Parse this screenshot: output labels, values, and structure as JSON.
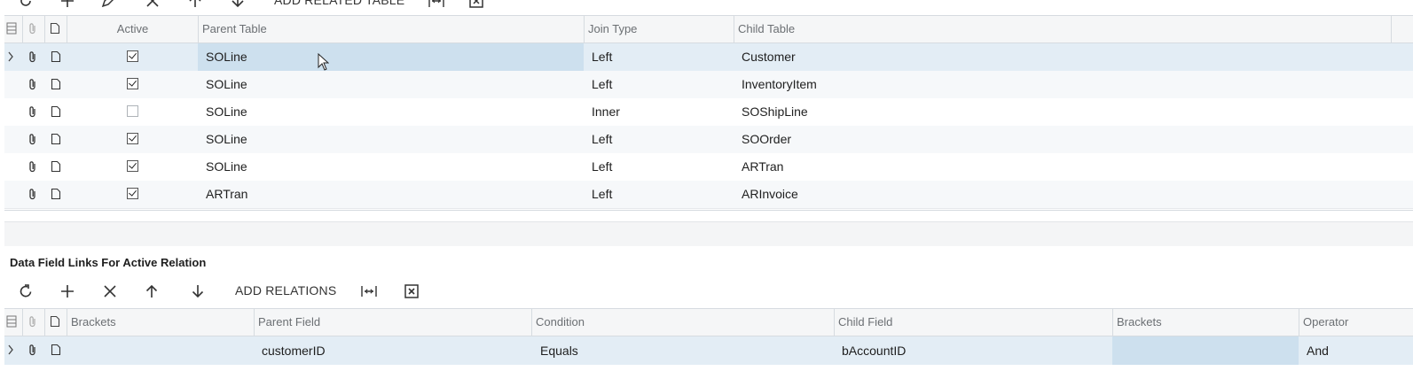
{
  "top_toolbar": {
    "add_related_table_label": "ADD RELATED TABLE"
  },
  "relations_grid": {
    "columns": {
      "active": "Active",
      "parent_table": "Parent Table",
      "join_type": "Join Type",
      "child_table": "Child Table"
    },
    "rows": [
      {
        "active": true,
        "parent_table": "SOLine",
        "join_type": "Left",
        "child_table": "Customer"
      },
      {
        "active": true,
        "parent_table": "SOLine",
        "join_type": "Left",
        "child_table": "InventoryItem"
      },
      {
        "active": false,
        "parent_table": "SOLine",
        "join_type": "Inner",
        "child_table": "SOShipLine"
      },
      {
        "active": true,
        "parent_table": "SOLine",
        "join_type": "Left",
        "child_table": "SOOrder"
      },
      {
        "active": true,
        "parent_table": "SOLine",
        "join_type": "Left",
        "child_table": "ARTran"
      },
      {
        "active": true,
        "parent_table": "ARTran",
        "join_type": "Left",
        "child_table": "ARInvoice"
      }
    ]
  },
  "links_section": {
    "title": "Data Field Links For Active Relation",
    "toolbar": {
      "add_relations_label": "ADD RELATIONS"
    },
    "columns": {
      "brackets_open": "Brackets",
      "parent_field": "Parent Field",
      "condition": "Condition",
      "child_field": "Child Field",
      "brackets_close": "Brackets",
      "operator": "Operator"
    },
    "rows": [
      {
        "brackets_open": "",
        "parent_field": "customerID",
        "condition": "Equals",
        "child_field": "bAccountID",
        "brackets_close": "",
        "operator": "And"
      }
    ]
  },
  "icons": {
    "refresh": "refresh-icon",
    "add": "plus-icon",
    "delete": "close-icon",
    "move_up": "arrow-up-icon",
    "move_down": "arrow-down-icon",
    "fit": "fit-width-icon",
    "excel": "excel-export-icon",
    "attachment": "paperclip-icon",
    "note": "note-icon",
    "expand": "chevron-right-icon",
    "settings": "grid-settings-icon"
  },
  "colors": {
    "selected_row": "#e3edf5",
    "active_cell": "#cde0ee",
    "header_bg": "#f5f6f7",
    "border": "#d6dbe0"
  }
}
